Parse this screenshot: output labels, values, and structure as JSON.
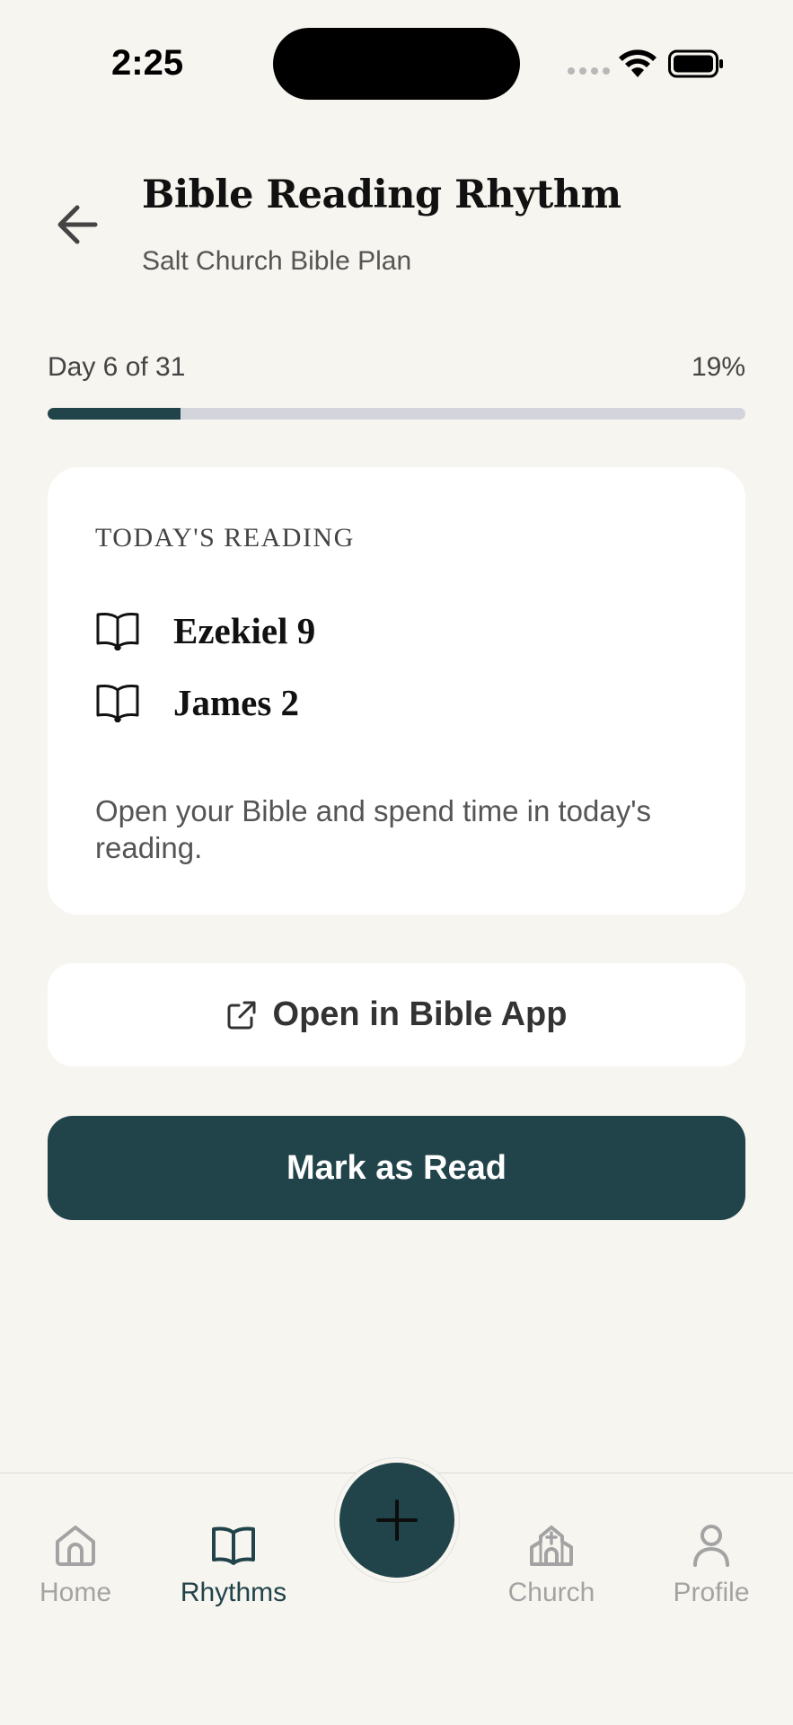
{
  "status_bar": {
    "time": "2:25"
  },
  "header": {
    "title": "Bible Reading Rhythm",
    "subtitle": "Salt Church Bible Plan",
    "back_icon": "arrow-left-icon"
  },
  "progress": {
    "label": "Day 6 of 31",
    "percent_text": "19%",
    "percent_value": 19,
    "fill_color": "#21434a",
    "track_color": "#d4d5dc"
  },
  "reading_card": {
    "heading": "TODAY'S READING",
    "items": [
      {
        "icon": "open-book-icon",
        "text": "Ezekiel 9"
      },
      {
        "icon": "open-book-icon",
        "text": "James 2"
      }
    ],
    "note": "Open your Bible and spend time in today's reading."
  },
  "actions": {
    "open_app_label": "Open in Bible App",
    "open_app_icon": "external-link-icon",
    "mark_read_label": "Mark as Read"
  },
  "tab_bar": {
    "items": [
      {
        "label": "Home",
        "icon": "home-icon",
        "active": false
      },
      {
        "label": "Rhythms",
        "icon": "open-book-icon",
        "active": true
      },
      {
        "label": "Church",
        "icon": "church-icon",
        "active": false
      },
      {
        "label": "Profile",
        "icon": "person-icon",
        "active": false
      }
    ],
    "fab_icon": "plus-icon"
  },
  "colors": {
    "background": "#f7f5ef",
    "primary": "#21434a",
    "inactive": "#a3a3a3"
  }
}
